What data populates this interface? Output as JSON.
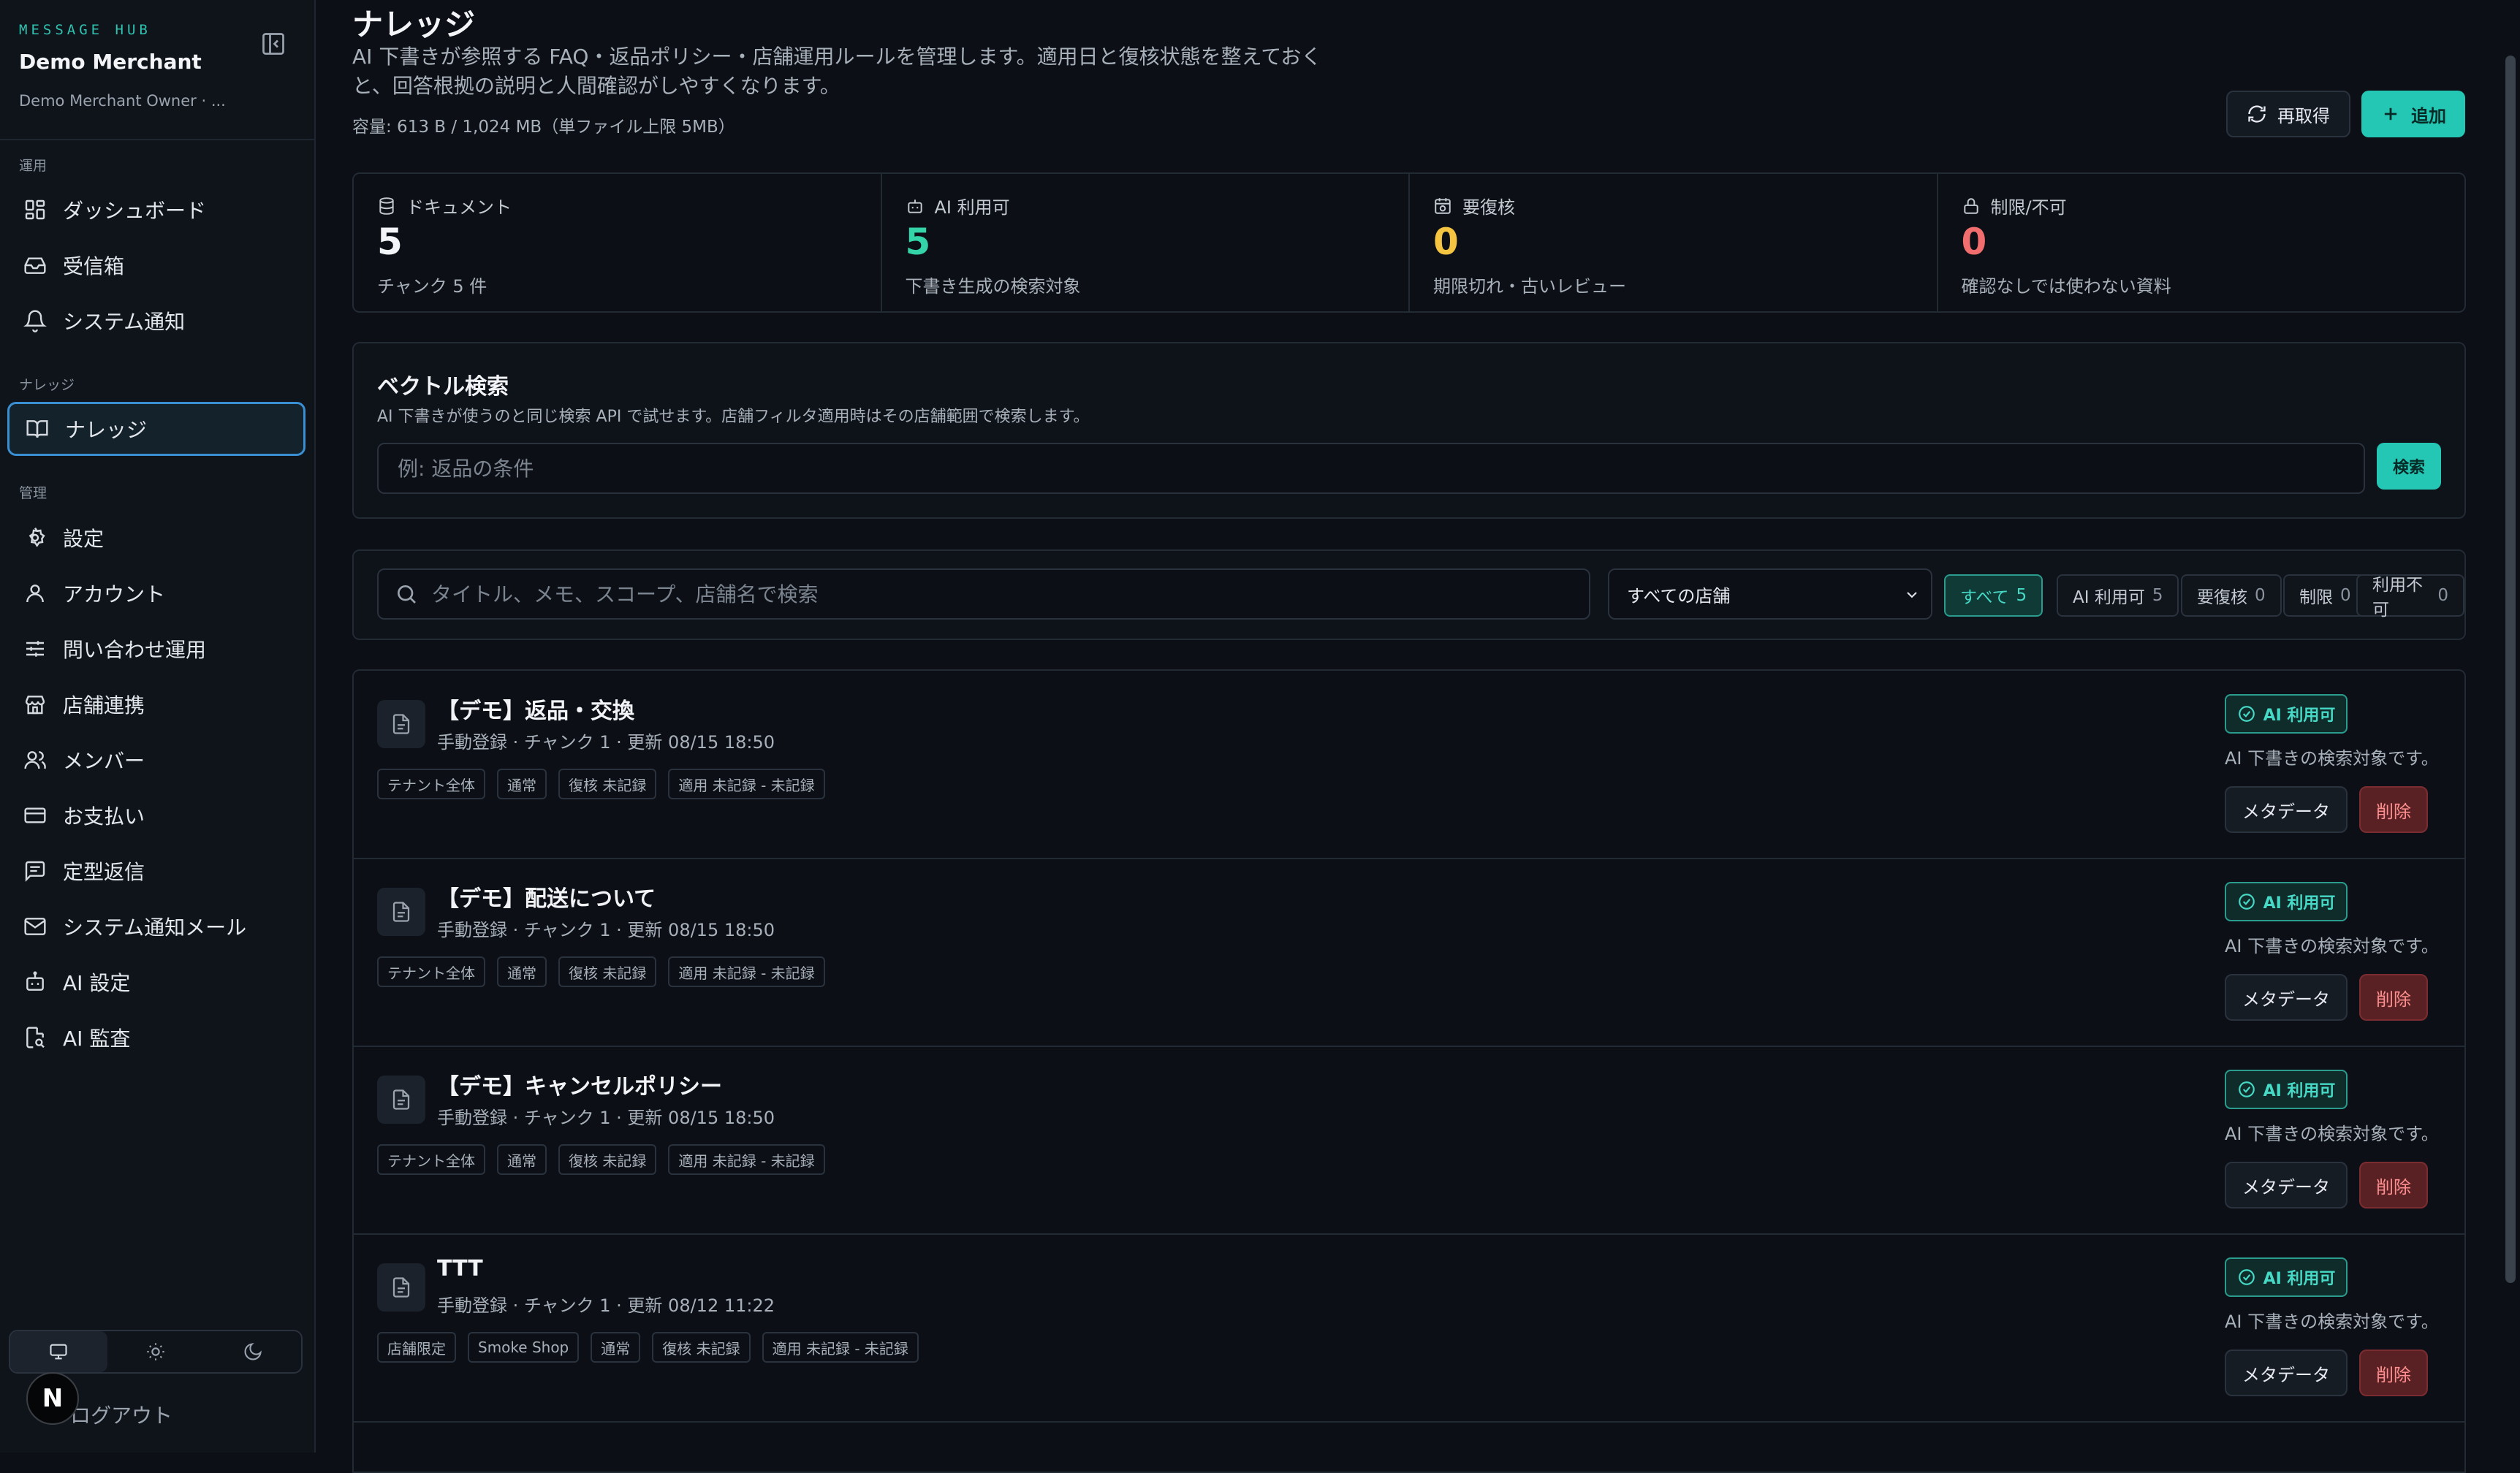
{
  "sidebar": {
    "kicker": "MESSAGE HUB",
    "merchant": "Demo Merchant",
    "owner": "Demo Merchant Owner · ...",
    "sections": {
      "operations": "運用",
      "knowledge": "ナレッジ",
      "admin": "管理"
    },
    "items": {
      "dashboard": "ダッシュボード",
      "inbox": "受信箱",
      "system_notice": "システム通知",
      "knowledge": "ナレッジ",
      "settings": "設定",
      "account": "アカウント",
      "inquiry_ops": "問い合わせ運用",
      "store_integration": "店舗連携",
      "members": "メンバー",
      "billing": "お支払い",
      "templates": "定型返信",
      "system_mail": "システム通知メール",
      "ai_settings": "AI 設定",
      "ai_audit": "AI 監査"
    },
    "logout": "ログアウト",
    "avatar_letter": "N"
  },
  "header": {
    "title": "ナレッジ",
    "description": "AI 下書きが参照する FAQ・返品ポリシー・店舗運用ルールを管理します。適用日と復核状態を整えておくと、回答根拠の説明と人間確認がしやすくなります。",
    "capacity": "容量: 613 B / 1,024 MB（単ファイル上限 5MB）",
    "refresh_label": "再取得",
    "add_label": "追加"
  },
  "stats": [
    {
      "label": "ドキュメント",
      "value": "5",
      "sub": "チャンク 5 件",
      "color": "#f2f4f7"
    },
    {
      "label": "AI 利用可",
      "value": "5",
      "sub": "下書き生成の検索対象",
      "color": "#34d3a8"
    },
    {
      "label": "要復核",
      "value": "0",
      "sub": "期限切れ・古いレビュー",
      "color": "#f5c542"
    },
    {
      "label": "制限/不可",
      "value": "0",
      "sub": "確認なしでは使わない資料",
      "color": "#f26d6d"
    }
  ],
  "vector_search": {
    "title": "ベクトル検索",
    "description": "AI 下書きが使うのと同じ検索 API で試せます。店舗フィルタ適用時はその店舗範囲で検索します。",
    "placeholder": "例: 返品の条件",
    "button": "検索"
  },
  "filters": {
    "search_placeholder": "タイトル、メモ、スコープ、店舗名で検索",
    "store_select": "すべての店舗",
    "chips": [
      {
        "label": "すべて",
        "count": "5"
      },
      {
        "label": "AI 利用可",
        "count": "5"
      },
      {
        "label": "要復核",
        "count": "0"
      },
      {
        "label": "制限",
        "count": "0"
      },
      {
        "label": "利用不可",
        "count": "0"
      }
    ]
  },
  "documents": [
    {
      "title": "【デモ】返品・交換",
      "meta": "手動登録 · チャンク 1 · 更新 08/15 18:50",
      "tags": [
        "テナント全体",
        "通常",
        "復核 未記録",
        "適用 未記録 - 未記録"
      ],
      "badge": "AI 利用可",
      "note": "AI 下書きの検索対象です。",
      "meta_btn": "メタデータ",
      "del_btn": "削除"
    },
    {
      "title": "【デモ】配送について",
      "meta": "手動登録 · チャンク 1 · 更新 08/15 18:50",
      "tags": [
        "テナント全体",
        "通常",
        "復核 未記録",
        "適用 未記録 - 未記録"
      ],
      "badge": "AI 利用可",
      "note": "AI 下書きの検索対象です。",
      "meta_btn": "メタデータ",
      "del_btn": "削除"
    },
    {
      "title": "【デモ】キャンセルポリシー",
      "meta": "手動登録 · チャンク 1 · 更新 08/15 18:50",
      "tags": [
        "テナント全体",
        "通常",
        "復核 未記録",
        "適用 未記録 - 未記録"
      ],
      "badge": "AI 利用可",
      "note": "AI 下書きの検索対象です。",
      "meta_btn": "メタデータ",
      "del_btn": "削除"
    },
    {
      "title": "TTT",
      "meta": "手動登録 · チャンク 1 · 更新 08/12 11:22",
      "tags": [
        "店舗限定",
        "Smoke Shop",
        "通常",
        "復核 未記録",
        "適用 未記録 - 未記録"
      ],
      "badge": "AI 利用可",
      "note": "AI 下書きの検索対象です。",
      "meta_btn": "メタデータ",
      "del_btn": "削除"
    }
  ]
}
